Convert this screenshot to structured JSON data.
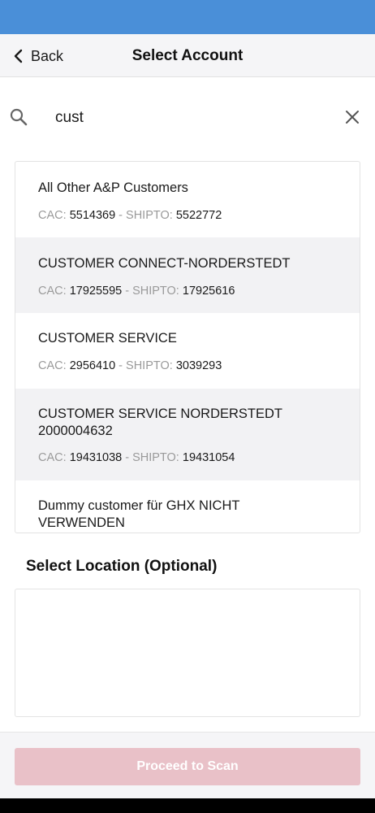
{
  "header": {
    "back_label": "Back",
    "title": "Select Account"
  },
  "search": {
    "value": "cust"
  },
  "accounts": [
    {
      "name": "All Other A&P Customers",
      "cac_label": "CAC:",
      "cac": "5514369",
      "sep": " - ",
      "shipto_label": "SHIPTO:",
      "shipto": "5522772"
    },
    {
      "name": "CUSTOMER CONNECT-NORDERSTEDT",
      "cac_label": "CAC:",
      "cac": "17925595",
      "sep": " - ",
      "shipto_label": "SHIPTO:",
      "shipto": "17925616"
    },
    {
      "name": "CUSTOMER SERVICE",
      "cac_label": "CAC:",
      "cac": "2956410",
      "sep": " - ",
      "shipto_label": "SHIPTO:",
      "shipto": "3039293"
    },
    {
      "name_line1": "CUSTOMER SERVICE NORDERSTEDT",
      "name_line2": "2000004632",
      "cac_label": "CAC:",
      "cac": "19431038",
      "sep": " - ",
      "shipto_label": "SHIPTO:",
      "shipto": "19431054"
    },
    {
      "name_line1": "Dummy customer für GHX NICHT",
      "name_line2": "VERWENDEN"
    }
  ],
  "location": {
    "label": "Select Location (Optional)"
  },
  "footer": {
    "proceed_label": "Proceed to Scan"
  },
  "colors": {
    "status_bar": "#4a8fd8",
    "proceed_disabled": "#e9c1c8"
  }
}
